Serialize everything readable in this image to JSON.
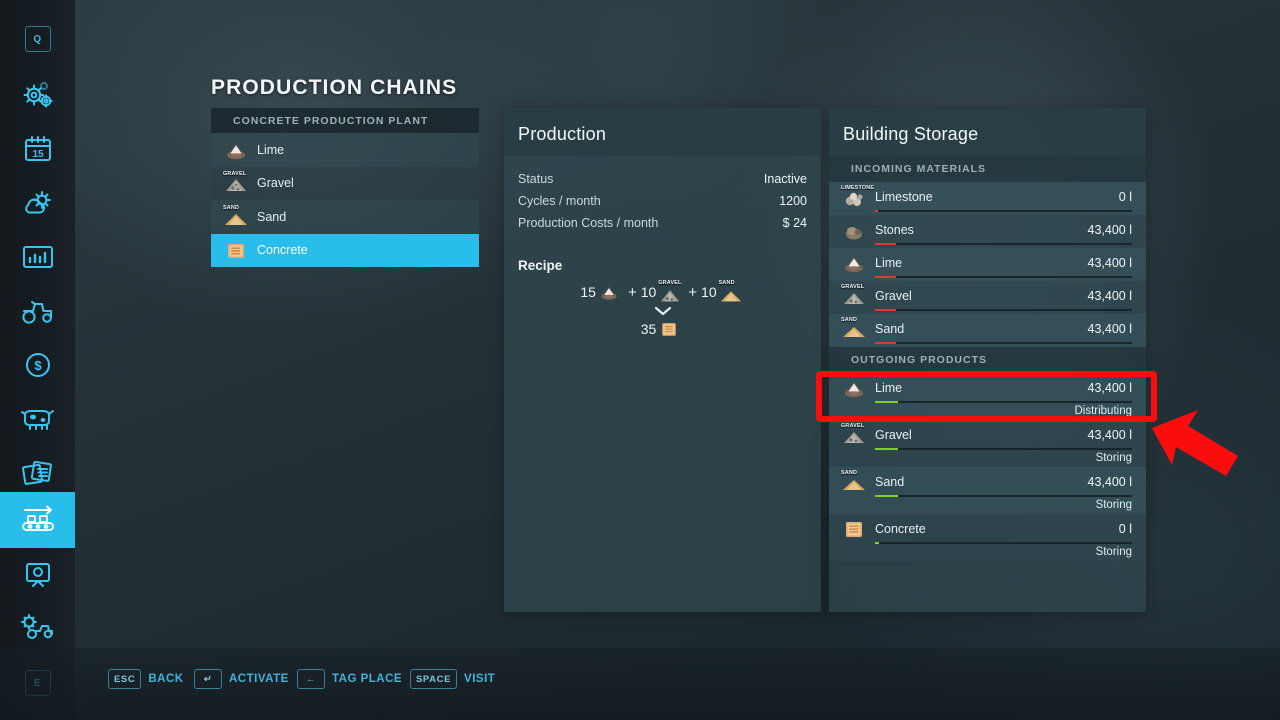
{
  "page_title": "PRODUCTION CHAINS",
  "sidebar": {
    "accent_color": "#29bdec",
    "items": [
      {
        "name": "quick-menu",
        "icon": "key-q-icon",
        "label": "Q",
        "active": false
      },
      {
        "name": "settings",
        "icon": "gears-icon",
        "label": "",
        "active": false
      },
      {
        "name": "calendar",
        "icon": "calendar-15-icon",
        "label": "15",
        "active": false
      },
      {
        "name": "weather",
        "icon": "weather-sun-cloud-icon",
        "label": "",
        "active": false
      },
      {
        "name": "statistics",
        "icon": "bar-chart-icon",
        "label": "",
        "active": false
      },
      {
        "name": "vehicles",
        "icon": "tractor-icon",
        "label": "",
        "active": false
      },
      {
        "name": "finances",
        "icon": "dollar-circle-icon",
        "label": "",
        "active": false
      },
      {
        "name": "animals",
        "icon": "cow-icon",
        "label": "",
        "active": false
      },
      {
        "name": "contracts",
        "icon": "documents-icon",
        "label": "",
        "active": false
      },
      {
        "name": "production-chains",
        "icon": "conveyor-belt-icon",
        "label": "",
        "active": true
      },
      {
        "name": "ai-workers",
        "icon": "helper-screen-icon",
        "label": "",
        "active": false
      },
      {
        "name": "construction",
        "icon": "gear-tractor-icon",
        "label": "",
        "active": false
      },
      {
        "name": "exit",
        "icon": "key-e-icon",
        "label": "E",
        "active": false
      }
    ]
  },
  "production_list": {
    "header": "CONCRETE PRODUCTION PLANT",
    "rows": [
      {
        "label": "Lime",
        "icon": "lime-icon",
        "selected": false
      },
      {
        "label": "Gravel",
        "icon": "gravel-icon",
        "selected": false
      },
      {
        "label": "Sand",
        "icon": "sand-icon",
        "selected": false
      },
      {
        "label": "Concrete",
        "icon": "concrete-icon",
        "selected": true
      }
    ]
  },
  "production": {
    "title": "Production",
    "stats": [
      {
        "key": "Status",
        "value": "Inactive"
      },
      {
        "key": "Cycles / month",
        "value": "1200"
      },
      {
        "key": "Production Costs / month",
        "value": "$ 24"
      }
    ],
    "recipe_label": "Recipe",
    "recipe_inputs": [
      {
        "amount": "15",
        "icon": "lime-icon",
        "material": "Lime"
      },
      {
        "amount": "10",
        "icon": "gravel-icon",
        "material": "Gravel"
      },
      {
        "amount": "10",
        "icon": "sand-icon",
        "material": "Sand"
      }
    ],
    "recipe_plus": "+",
    "recipe_output": {
      "amount": "35",
      "icon": "concrete-icon",
      "material": "Concrete"
    }
  },
  "storage": {
    "title": "Building Storage",
    "incoming_label": "INCOMING MATERIALS",
    "outgoing_label": "OUTGOING PRODUCTS",
    "incoming_bar_color": "#e8352b",
    "outgoing_bar_color": "#7ed321",
    "incoming": [
      {
        "name": "Limestone",
        "icon": "limestone-icon",
        "amount": "0 l",
        "fill_pct": 1,
        "state": ""
      },
      {
        "name": "Stones",
        "icon": "stones-icon",
        "amount": "43,400 l",
        "fill_pct": 8,
        "state": ""
      },
      {
        "name": "Lime",
        "icon": "lime-icon",
        "amount": "43,400 l",
        "fill_pct": 8,
        "state": ""
      },
      {
        "name": "Gravel",
        "icon": "gravel-icon",
        "amount": "43,400 l",
        "fill_pct": 8,
        "state": ""
      },
      {
        "name": "Sand",
        "icon": "sand-icon",
        "amount": "43,400 l",
        "fill_pct": 8,
        "state": ""
      }
    ],
    "outgoing": [
      {
        "name": "Lime",
        "icon": "lime-icon",
        "amount": "43,400 l",
        "fill_pct": 9,
        "state": "Distributing",
        "highlighted": true
      },
      {
        "name": "Gravel",
        "icon": "gravel-icon",
        "amount": "43,400 l",
        "fill_pct": 9,
        "state": "Storing",
        "highlighted": false
      },
      {
        "name": "Sand",
        "icon": "sand-icon",
        "amount": "43,400 l",
        "fill_pct": 9,
        "state": "Storing",
        "highlighted": false
      },
      {
        "name": "Concrete",
        "icon": "concrete-icon",
        "amount": "0 l",
        "fill_pct": 1,
        "state": "Storing",
        "highlighted": false
      }
    ]
  },
  "helpbar": [
    {
      "key": "ESC",
      "label": "BACK",
      "icon": "esc-key-icon"
    },
    {
      "key": "↵",
      "label": "ACTIVATE",
      "icon": "enter-key-icon"
    },
    {
      "key": "←",
      "label": "TAG PLACE",
      "icon": "left-arrow-key-icon"
    },
    {
      "key": "SPACE",
      "label": "VISIT",
      "icon": "space-key-icon"
    }
  ],
  "annotation": {
    "color": "#fb0d0d",
    "shape": "rectangle-and-arrow",
    "target": "outgoing-lime-row"
  }
}
